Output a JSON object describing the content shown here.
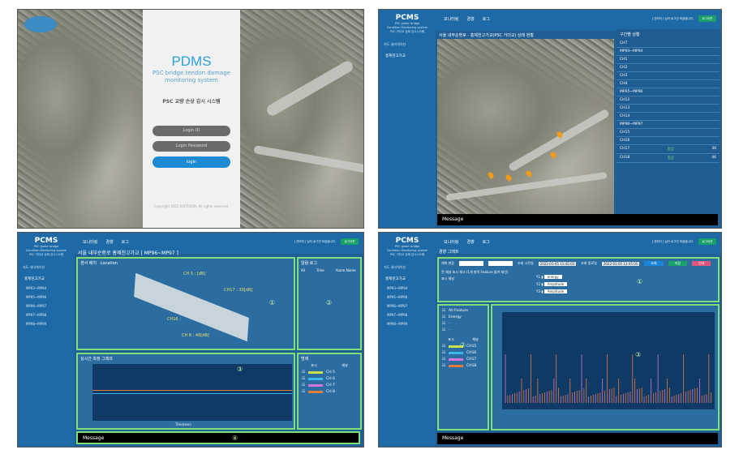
{
  "login": {
    "title": "PDMS",
    "subtitle_line1": "PSC bridge tendon damage",
    "subtitle_line2": "monitoring system",
    "korean": "PSC 교량 손상 감시 시스템",
    "id_placeholder": "Login ID",
    "pw_placeholder": "Login Password",
    "login_button": "login",
    "copyright": "Copyright 2022 BISTEXON, All rights reserved."
  },
  "app": {
    "brand": "PCMS",
    "brand_sub1": "PSC girder bridge",
    "brand_sub2": "Condition Monitoring system",
    "brand_sub3": "PSC 거더교 상태 감시시스템",
    "nav_title": "지도 네비게이션",
    "group": "홍제천고가교",
    "tab_monitoring": "모니터링",
    "tab_alarm": "경향",
    "tab_log": "로그",
    "status": "[ 관리자 ] 님이 로그인 하셨습니다.",
    "logout": "로그아웃",
    "message": "Message"
  },
  "map": {
    "title": "서울 내부순환로 - 홍제천고가교(PSC 거더교) 상태 현황",
    "panel_title": "구간별 상황",
    "rows": [
      {
        "label": "CH7",
        "state": "",
        "value": ""
      },
      {
        "label": "MP93~MP94",
        "state": "",
        "value": ""
      },
      {
        "label": "CH1",
        "state": "",
        "value": ""
      },
      {
        "label": "CH2",
        "state": "",
        "value": ""
      },
      {
        "label": "CH3",
        "state": "",
        "value": ""
      },
      {
        "label": "CH4",
        "state": "",
        "value": ""
      },
      {
        "label": "MP95~MP96",
        "state": "",
        "value": ""
      },
      {
        "label": "CH12",
        "state": "",
        "value": ""
      },
      {
        "label": "CH13",
        "state": "",
        "value": ""
      },
      {
        "label": "CH14",
        "state": "",
        "value": ""
      },
      {
        "label": "MP96~MP97",
        "state": "",
        "value": ""
      },
      {
        "label": "CH15",
        "state": "",
        "value": ""
      },
      {
        "label": "CH16",
        "state": "",
        "value": ""
      },
      {
        "label": "CH17",
        "state": "정상",
        "value": "30"
      },
      {
        "label": "CH18",
        "state": "정상",
        "value": "46"
      }
    ]
  },
  "sidebar_items": [
    "MP93~MP94",
    "MP95~MP96",
    "MP96~MP97",
    "MP97~MP98",
    "MP98~MP99"
  ],
  "detail": {
    "title": "서울 내부순환로 홍제천고가교 [ MP96~MP97 ]",
    "tab1": "센서 배치",
    "tab2": "Location",
    "ch5": "CH 5 : [dB]",
    "ch17": "CH17 : 30[dB]",
    "ch16": "CH16 :",
    "ch8": "CH 8 : 46[dB]",
    "alarm_log": "알람 로그",
    "col_all": "All",
    "col_time": "Time",
    "col_name": "Alarm Name",
    "rt_graph": "실시간 측정 그래프",
    "legend_title": "범례",
    "legend_h1": "표시",
    "legend_h2": "채널",
    "legend": [
      {
        "name": "CH 5",
        "color": "#c9e04a"
      },
      {
        "name": "CH 6",
        "color": "#3fb7e8"
      },
      {
        "name": "CH 7",
        "color": "#d673d9"
      },
      {
        "name": "CH 8",
        "color": "#e27a3a"
      }
    ],
    "x_label": "Time(sec)",
    "y_label": "Energy (a.u.)",
    "circles": [
      "①",
      "②",
      "③",
      "④"
    ]
  },
  "trend": {
    "title": "경향 그래프",
    "label_site": "계측 현장",
    "label_start": "조회 시작일",
    "start": "2022-01-05 11:45:05",
    "label_end": "조회 종료일",
    "end": "2022-01-05 13:45:05",
    "b1": "조회",
    "b2": "저장",
    "b3": "인쇄",
    "cb": "전 채널 표시 체크 (1개 항목 Feature 을켜 재인)",
    "label_channel": "표시 채널",
    "y1": "Y1",
    "y2": "Y2",
    "y3": "Y3",
    "y1v": "energy",
    "y2v": "Amplitude",
    "y3v": "Amplitude",
    "feat_all": "All Feature",
    "feat_energy": "Energy",
    "feat_dash1": "-",
    "feat_dash2": "-",
    "ch_h1": "표시",
    "ch_h2": "채널",
    "channels": [
      {
        "name": "CH15",
        "color": "#c9e04a"
      },
      {
        "name": "CH16",
        "color": "#3fb7e8"
      },
      {
        "name": "CH17",
        "color": "#d673d9"
      },
      {
        "name": "CH18",
        "color": "#e27a3a"
      }
    ],
    "circles": [
      "①",
      "②",
      "③"
    ]
  }
}
